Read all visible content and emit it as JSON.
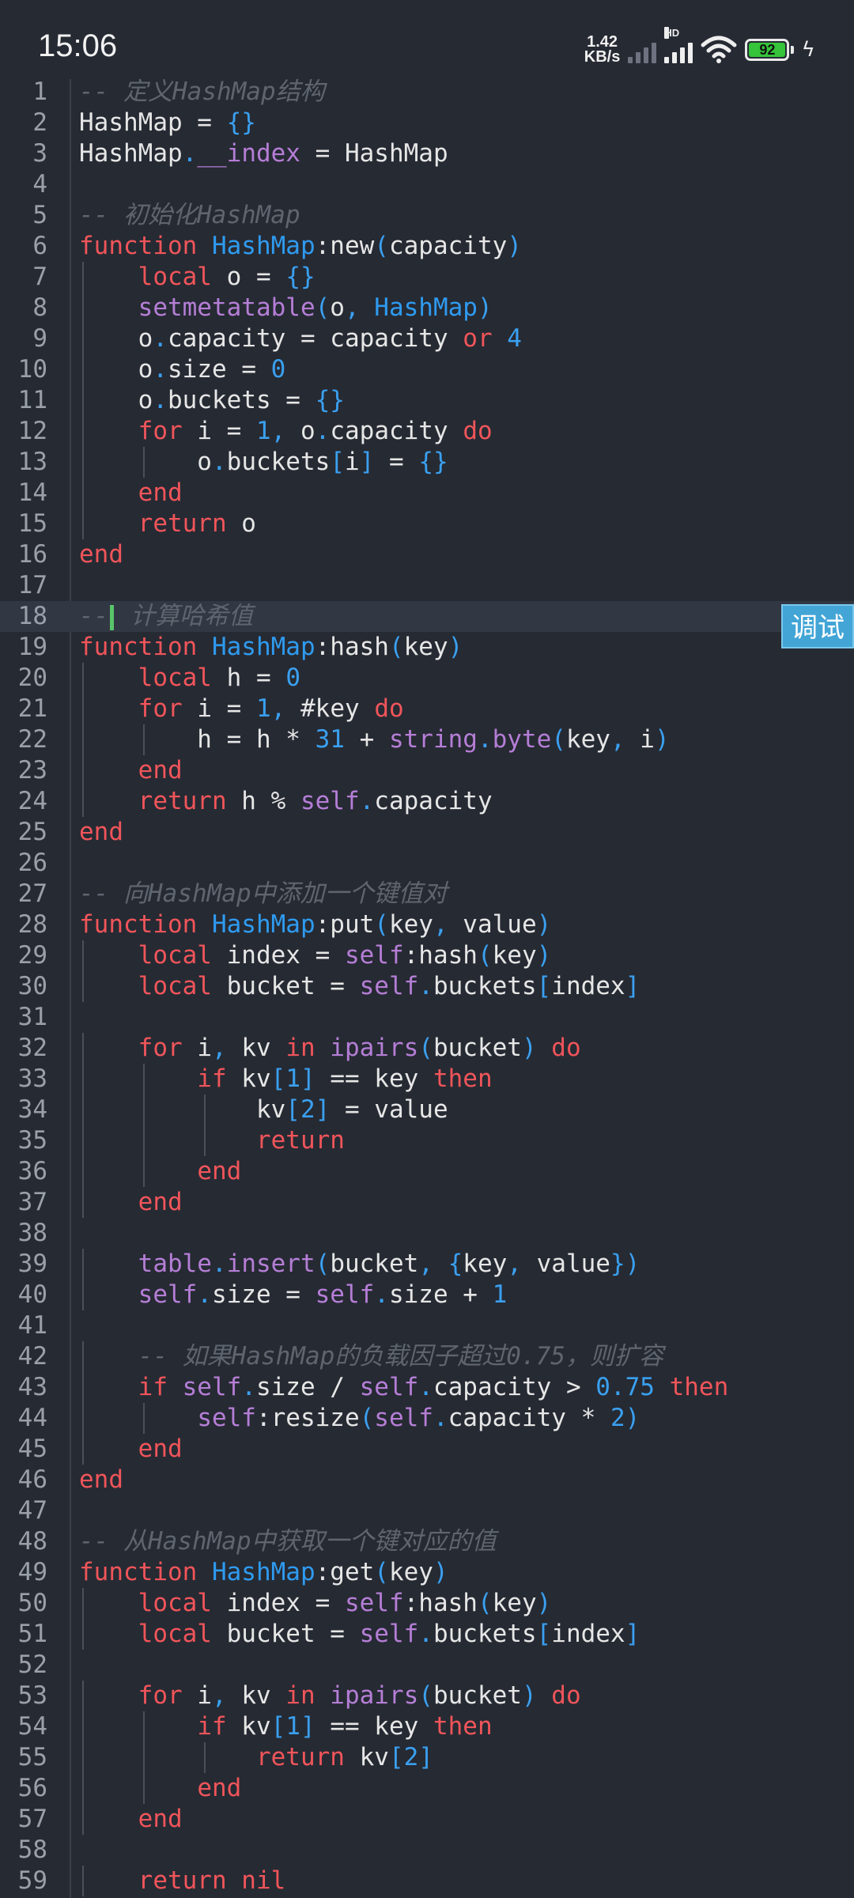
{
  "status": {
    "time": "15:06",
    "net_speed_top": "1.42",
    "net_speed_bottom": "KB/s",
    "hd": "HD",
    "battery": "92"
  },
  "debug_button": "调试",
  "lines": [
    {
      "n": "1",
      "s": [
        [
          "cm",
          "-- 定义HashMap结构"
        ]
      ]
    },
    {
      "n": "2",
      "s": [
        [
          "",
          "HashMap = "
        ],
        [
          "p",
          "{}"
        ]
      ]
    },
    {
      "n": "3",
      "s": [
        [
          "",
          "HashMap"
        ],
        [
          "p",
          "."
        ],
        [
          "bi",
          "__index"
        ],
        [
          "",
          " = HashMap"
        ]
      ]
    },
    {
      "n": "4",
      "s": []
    },
    {
      "n": "5",
      "s": [
        [
          "cm",
          "-- 初始化HashMap"
        ]
      ]
    },
    {
      "n": "6",
      "s": [
        [
          "kw",
          "function "
        ],
        [
          "fn",
          "HashMap"
        ],
        [
          "",
          ":new"
        ],
        [
          "p",
          "("
        ],
        [
          "",
          "capacity"
        ],
        [
          "p",
          ")"
        ]
      ]
    },
    {
      "n": "7",
      "s": [
        [
          "",
          "    "
        ],
        [
          "kw",
          "local"
        ],
        [
          "",
          " o = "
        ],
        [
          "p",
          "{}"
        ]
      ]
    },
    {
      "n": "8",
      "s": [
        [
          "",
          "    "
        ],
        [
          "bi",
          "setmetatable"
        ],
        [
          "p",
          "("
        ],
        [
          "",
          "o"
        ],
        [
          "p",
          ", "
        ],
        [
          "fn",
          "HashMap"
        ],
        [
          "p",
          ")"
        ]
      ]
    },
    {
      "n": "9",
      "s": [
        [
          "",
          "    o"
        ],
        [
          "p",
          "."
        ],
        [
          "",
          "capacity = capacity "
        ],
        [
          "kw",
          "or"
        ],
        [
          "num",
          " 4"
        ]
      ]
    },
    {
      "n": "10",
      "s": [
        [
          "",
          "    o"
        ],
        [
          "p",
          "."
        ],
        [
          "",
          "size = "
        ],
        [
          "num",
          "0"
        ]
      ]
    },
    {
      "n": "11",
      "s": [
        [
          "",
          "    o"
        ],
        [
          "p",
          "."
        ],
        [
          "",
          "buckets = "
        ],
        [
          "p",
          "{}"
        ]
      ]
    },
    {
      "n": "12",
      "s": [
        [
          "",
          "    "
        ],
        [
          "kw",
          "for"
        ],
        [
          "",
          " i = "
        ],
        [
          "num",
          "1"
        ],
        [
          "p",
          ","
        ],
        [
          "",
          " o"
        ],
        [
          "p",
          "."
        ],
        [
          "",
          "capacity "
        ],
        [
          "kw",
          "do"
        ]
      ]
    },
    {
      "n": "13",
      "s": [
        [
          "",
          "        o"
        ],
        [
          "p",
          "."
        ],
        [
          "",
          "buckets"
        ],
        [
          "p",
          "["
        ],
        [
          "",
          "i"
        ],
        [
          "p",
          "]"
        ],
        [
          "",
          " = "
        ],
        [
          "p",
          "{}"
        ]
      ]
    },
    {
      "n": "14",
      "s": [
        [
          "",
          "    "
        ],
        [
          "kw",
          "end"
        ]
      ]
    },
    {
      "n": "15",
      "s": [
        [
          "",
          "    "
        ],
        [
          "kw",
          "return"
        ],
        [
          "",
          " o"
        ]
      ]
    },
    {
      "n": "16",
      "s": [
        [
          "kw",
          "end"
        ]
      ]
    },
    {
      "n": "17",
      "s": []
    },
    {
      "n": "18",
      "s": [
        [
          "cm",
          "--"
        ],
        [
          "cursor",
          ""
        ],
        [
          "cm",
          " 计算哈希值"
        ]
      ],
      "current": true
    },
    {
      "n": "19",
      "s": [
        [
          "kw",
          "function "
        ],
        [
          "fn",
          "HashMap"
        ],
        [
          "",
          ":hash"
        ],
        [
          "p",
          "("
        ],
        [
          "",
          "key"
        ],
        [
          "p",
          ")"
        ]
      ]
    },
    {
      "n": "20",
      "s": [
        [
          "",
          "    "
        ],
        [
          "kw",
          "local"
        ],
        [
          "",
          " h = "
        ],
        [
          "num",
          "0"
        ]
      ]
    },
    {
      "n": "21",
      "s": [
        [
          "",
          "    "
        ],
        [
          "kw",
          "for"
        ],
        [
          "",
          " i = "
        ],
        [
          "num",
          "1"
        ],
        [
          "p",
          ","
        ],
        [
          "",
          " #key "
        ],
        [
          "kw",
          "do"
        ]
      ]
    },
    {
      "n": "22",
      "s": [
        [
          "",
          "        h = h * "
        ],
        [
          "num",
          "31"
        ],
        [
          "",
          " + "
        ],
        [
          "bi",
          "string"
        ],
        [
          "p",
          "."
        ],
        [
          "bi",
          "byte"
        ],
        [
          "p",
          "("
        ],
        [
          "",
          "key"
        ],
        [
          "p",
          ","
        ],
        [
          "",
          " i"
        ],
        [
          "p",
          ")"
        ]
      ]
    },
    {
      "n": "23",
      "s": [
        [
          "",
          "    "
        ],
        [
          "kw",
          "end"
        ]
      ]
    },
    {
      "n": "24",
      "s": [
        [
          "",
          "    "
        ],
        [
          "kw",
          "return"
        ],
        [
          "",
          " h % "
        ],
        [
          "bi",
          "self"
        ],
        [
          "p",
          "."
        ],
        [
          "",
          "capacity"
        ]
      ]
    },
    {
      "n": "25",
      "s": [
        [
          "kw",
          "end"
        ]
      ]
    },
    {
      "n": "26",
      "s": []
    },
    {
      "n": "27",
      "s": [
        [
          "cm",
          "-- 向HashMap中添加一个键值对"
        ]
      ]
    },
    {
      "n": "28",
      "s": [
        [
          "kw",
          "function "
        ],
        [
          "fn",
          "HashMap"
        ],
        [
          "",
          ":put"
        ],
        [
          "p",
          "("
        ],
        [
          "",
          "key"
        ],
        [
          "p",
          ","
        ],
        [
          "",
          " value"
        ],
        [
          "p",
          ")"
        ]
      ]
    },
    {
      "n": "29",
      "s": [
        [
          "",
          "    "
        ],
        [
          "kw",
          "local"
        ],
        [
          "",
          " index = "
        ],
        [
          "bi",
          "self"
        ],
        [
          "",
          ":hash"
        ],
        [
          "p",
          "("
        ],
        [
          "",
          "key"
        ],
        [
          "p",
          ")"
        ]
      ]
    },
    {
      "n": "30",
      "s": [
        [
          "",
          "    "
        ],
        [
          "kw",
          "local"
        ],
        [
          "",
          " bucket = "
        ],
        [
          "bi",
          "self"
        ],
        [
          "p",
          "."
        ],
        [
          "",
          "buckets"
        ],
        [
          "p",
          "["
        ],
        [
          "",
          "index"
        ],
        [
          "p",
          "]"
        ]
      ]
    },
    {
      "n": "31",
      "s": []
    },
    {
      "n": "32",
      "s": [
        [
          "",
          "    "
        ],
        [
          "kw",
          "for"
        ],
        [
          "",
          " i"
        ],
        [
          "p",
          ","
        ],
        [
          "",
          " kv "
        ],
        [
          "kw",
          "in"
        ],
        [
          "bi",
          " ipairs"
        ],
        [
          "p",
          "("
        ],
        [
          "",
          "bucket"
        ],
        [
          "p",
          ")"
        ],
        [
          "kw",
          " do"
        ]
      ]
    },
    {
      "n": "33",
      "s": [
        [
          "",
          "        "
        ],
        [
          "kw",
          "if"
        ],
        [
          "",
          " kv"
        ],
        [
          "p",
          "["
        ],
        [
          "num",
          "1"
        ],
        [
          "p",
          "]"
        ],
        [
          "",
          " == key "
        ],
        [
          "kw",
          "then"
        ]
      ]
    },
    {
      "n": "34",
      "s": [
        [
          "",
          "            kv"
        ],
        [
          "p",
          "["
        ],
        [
          "num",
          "2"
        ],
        [
          "p",
          "]"
        ],
        [
          "",
          " = value"
        ]
      ]
    },
    {
      "n": "35",
      "s": [
        [
          "",
          "            "
        ],
        [
          "kw",
          "return"
        ]
      ]
    },
    {
      "n": "36",
      "s": [
        [
          "",
          "        "
        ],
        [
          "kw",
          "end"
        ]
      ]
    },
    {
      "n": "37",
      "s": [
        [
          "",
          "    "
        ],
        [
          "kw",
          "end"
        ]
      ]
    },
    {
      "n": "38",
      "s": []
    },
    {
      "n": "39",
      "s": [
        [
          "",
          "    "
        ],
        [
          "bi",
          "table"
        ],
        [
          "p",
          "."
        ],
        [
          "bi",
          "insert"
        ],
        [
          "p",
          "("
        ],
        [
          "",
          "bucket"
        ],
        [
          "p",
          ", {"
        ],
        [
          "",
          "key"
        ],
        [
          "p",
          ","
        ],
        [
          "",
          " value"
        ],
        [
          "p",
          "})"
        ]
      ]
    },
    {
      "n": "40",
      "s": [
        [
          "",
          "    "
        ],
        [
          "bi",
          "self"
        ],
        [
          "p",
          "."
        ],
        [
          "",
          "size = "
        ],
        [
          "bi",
          "self"
        ],
        [
          "p",
          "."
        ],
        [
          "",
          "size + "
        ],
        [
          "num",
          "1"
        ]
      ]
    },
    {
      "n": "41",
      "s": []
    },
    {
      "n": "42",
      "s": [
        [
          "",
          "    "
        ],
        [
          "cm",
          "-- 如果HashMap的负载因子超过0.75，则扩容"
        ]
      ]
    },
    {
      "n": "43",
      "s": [
        [
          "",
          "    "
        ],
        [
          "kw",
          "if"
        ],
        [
          "bi",
          " self"
        ],
        [
          "p",
          "."
        ],
        [
          "",
          "size / "
        ],
        [
          "bi",
          "self"
        ],
        [
          "p",
          "."
        ],
        [
          "",
          "capacity > "
        ],
        [
          "num",
          "0.75"
        ],
        [
          "kw",
          " then"
        ]
      ]
    },
    {
      "n": "44",
      "s": [
        [
          "",
          "        "
        ],
        [
          "bi",
          "self"
        ],
        [
          "",
          ":resize"
        ],
        [
          "p",
          "("
        ],
        [
          "bi",
          "self"
        ],
        [
          "p",
          "."
        ],
        [
          "",
          "capacity * "
        ],
        [
          "num",
          "2"
        ],
        [
          "p",
          ")"
        ]
      ]
    },
    {
      "n": "45",
      "s": [
        [
          "",
          "    "
        ],
        [
          "kw",
          "end"
        ]
      ]
    },
    {
      "n": "46",
      "s": [
        [
          "kw",
          "end"
        ]
      ]
    },
    {
      "n": "47",
      "s": []
    },
    {
      "n": "48",
      "s": [
        [
          "cm",
          "-- 从HashMap中获取一个键对应的值"
        ]
      ]
    },
    {
      "n": "49",
      "s": [
        [
          "kw",
          "function "
        ],
        [
          "fn",
          "HashMap"
        ],
        [
          "",
          ":get"
        ],
        [
          "p",
          "("
        ],
        [
          "",
          "key"
        ],
        [
          "p",
          ")"
        ]
      ]
    },
    {
      "n": "50",
      "s": [
        [
          "",
          "    "
        ],
        [
          "kw",
          "local"
        ],
        [
          "",
          " index = "
        ],
        [
          "bi",
          "self"
        ],
        [
          "",
          ":hash"
        ],
        [
          "p",
          "("
        ],
        [
          "",
          "key"
        ],
        [
          "p",
          ")"
        ]
      ]
    },
    {
      "n": "51",
      "s": [
        [
          "",
          "    "
        ],
        [
          "kw",
          "local"
        ],
        [
          "",
          " bucket = "
        ],
        [
          "bi",
          "self"
        ],
        [
          "p",
          "."
        ],
        [
          "",
          "buckets"
        ],
        [
          "p",
          "["
        ],
        [
          "",
          "index"
        ],
        [
          "p",
          "]"
        ]
      ]
    },
    {
      "n": "52",
      "s": []
    },
    {
      "n": "53",
      "s": [
        [
          "",
          "    "
        ],
        [
          "kw",
          "for"
        ],
        [
          "",
          " i"
        ],
        [
          "p",
          ","
        ],
        [
          "",
          " kv "
        ],
        [
          "kw",
          "in"
        ],
        [
          "bi",
          " ipairs"
        ],
        [
          "p",
          "("
        ],
        [
          "",
          "bucket"
        ],
        [
          "p",
          ")"
        ],
        [
          "kw",
          " do"
        ]
      ]
    },
    {
      "n": "54",
      "s": [
        [
          "",
          "        "
        ],
        [
          "kw",
          "if"
        ],
        [
          "",
          " kv"
        ],
        [
          "p",
          "["
        ],
        [
          "num",
          "1"
        ],
        [
          "p",
          "]"
        ],
        [
          "",
          " == key "
        ],
        [
          "kw",
          "then"
        ]
      ]
    },
    {
      "n": "55",
      "s": [
        [
          "",
          "            "
        ],
        [
          "kw",
          "return"
        ],
        [
          "",
          " kv"
        ],
        [
          "p",
          "["
        ],
        [
          "num",
          "2"
        ],
        [
          "p",
          "]"
        ]
      ]
    },
    {
      "n": "56",
      "s": [
        [
          "",
          "        "
        ],
        [
          "kw",
          "end"
        ]
      ]
    },
    {
      "n": "57",
      "s": [
        [
          "",
          "    "
        ],
        [
          "kw",
          "end"
        ]
      ]
    },
    {
      "n": "58",
      "s": []
    },
    {
      "n": "59",
      "s": [
        [
          "",
          "    "
        ],
        [
          "kw",
          "return nil"
        ]
      ]
    }
  ]
}
